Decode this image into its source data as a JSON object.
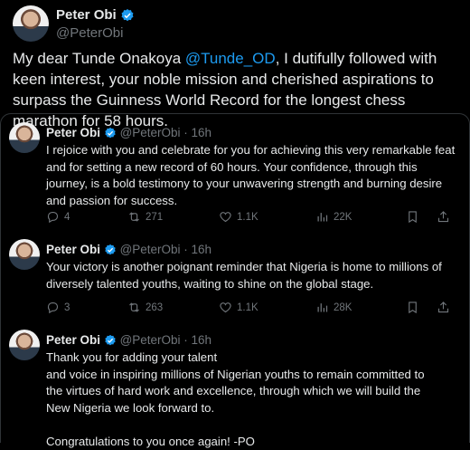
{
  "main": {
    "name": "Peter Obi",
    "handle": "@PeterObi",
    "text_before": "My dear Tunde Onakoya ",
    "mention": "@Tunde_OD",
    "text_after": ", I dutifully followed with keen interest, your noble mission and cherished aspirations to surpass the Guinness World Record for the longest chess marathon for 58 hours."
  },
  "replies": [
    {
      "name": "Peter Obi",
      "meta": "@PeterObi · 16h",
      "text": "I rejoice with you and celebrate for you for achieving this very remarkable feat and for setting a new record of 60 hours. Your confidence, through this journey, is a bold testimony to your unwavering strength and burning desire and passion for success.",
      "replies": "4",
      "reposts": "271",
      "likes": "1.1K",
      "views": "22K"
    },
    {
      "name": "Peter Obi",
      "meta": "@PeterObi · 16h",
      "text": "Your victory is another poignant reminder that Nigeria is home to millions of diversely talented youths, waiting to shine on the global stage.",
      "replies": "3",
      "reposts": "263",
      "likes": "1.1K",
      "views": "28K"
    },
    {
      "name": "Peter Obi",
      "meta": "@PeterObi · 16h",
      "text_lines": [
        "Thank you for adding your talent",
        "and voice in inspiring millions of Nigerian youths to remain committed to",
        "the virtues of hard work and excellence, through which we will build the",
        "New Nigeria we look forward to.",
        "",
        "Congratulations to you once again! -PO"
      ]
    }
  ],
  "colors": {
    "verified": "#1d9bf0",
    "muted": "#71767b",
    "link": "#1d9bf0"
  },
  "icons": [
    "verified-badge-icon",
    "reply-icon",
    "repost-icon",
    "like-icon",
    "views-icon",
    "bookmark-icon",
    "share-icon"
  ]
}
